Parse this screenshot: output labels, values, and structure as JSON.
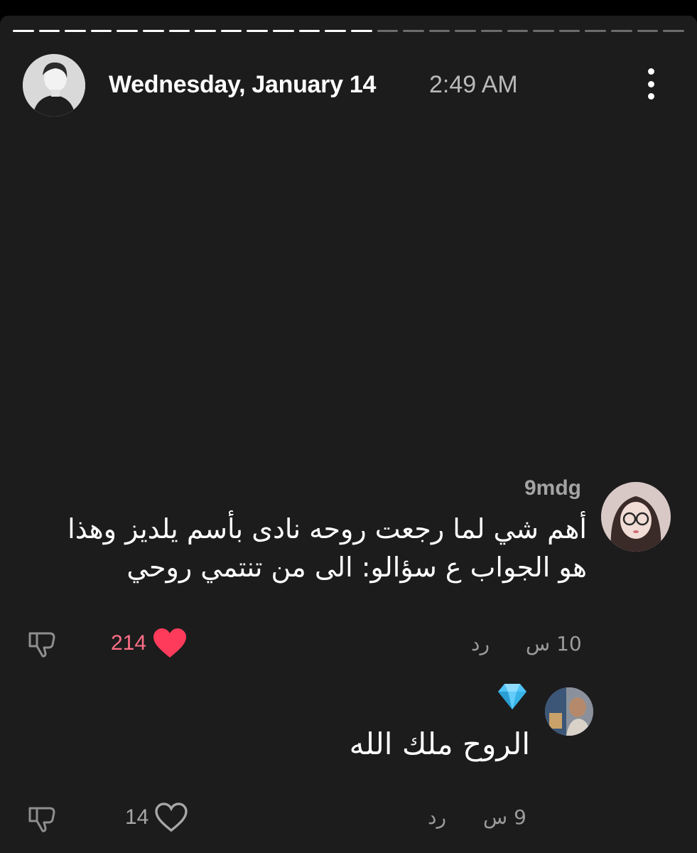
{
  "header": {
    "date": "Wednesday, January 14",
    "time": "2:49 AM"
  },
  "comments": [
    {
      "username": "9mdg",
      "text": "أهم شي لما رجعت روحه نادى بأسم يلديز وهذا هو الجواب ع سؤالو: الى من تنتمي روحي",
      "likes": "214",
      "liked": true,
      "time": "10 س",
      "reply_label": "رد"
    },
    {
      "username": "",
      "text": "الروح ملك الله",
      "likes": "14",
      "liked": false,
      "time": "9 س",
      "reply_label": "رد"
    }
  ],
  "colors": {
    "background": "#1c1c1d",
    "liked_heart": "#ff3b5c",
    "liked_count": "#ff6f85",
    "muted_text": "#9b9b9b",
    "badge": "#4fc3f7"
  },
  "icons": {
    "more": "more-vertical-icon",
    "dislike": "thumbs-down-icon",
    "like": "heart-icon",
    "badge": "diamond-icon"
  }
}
